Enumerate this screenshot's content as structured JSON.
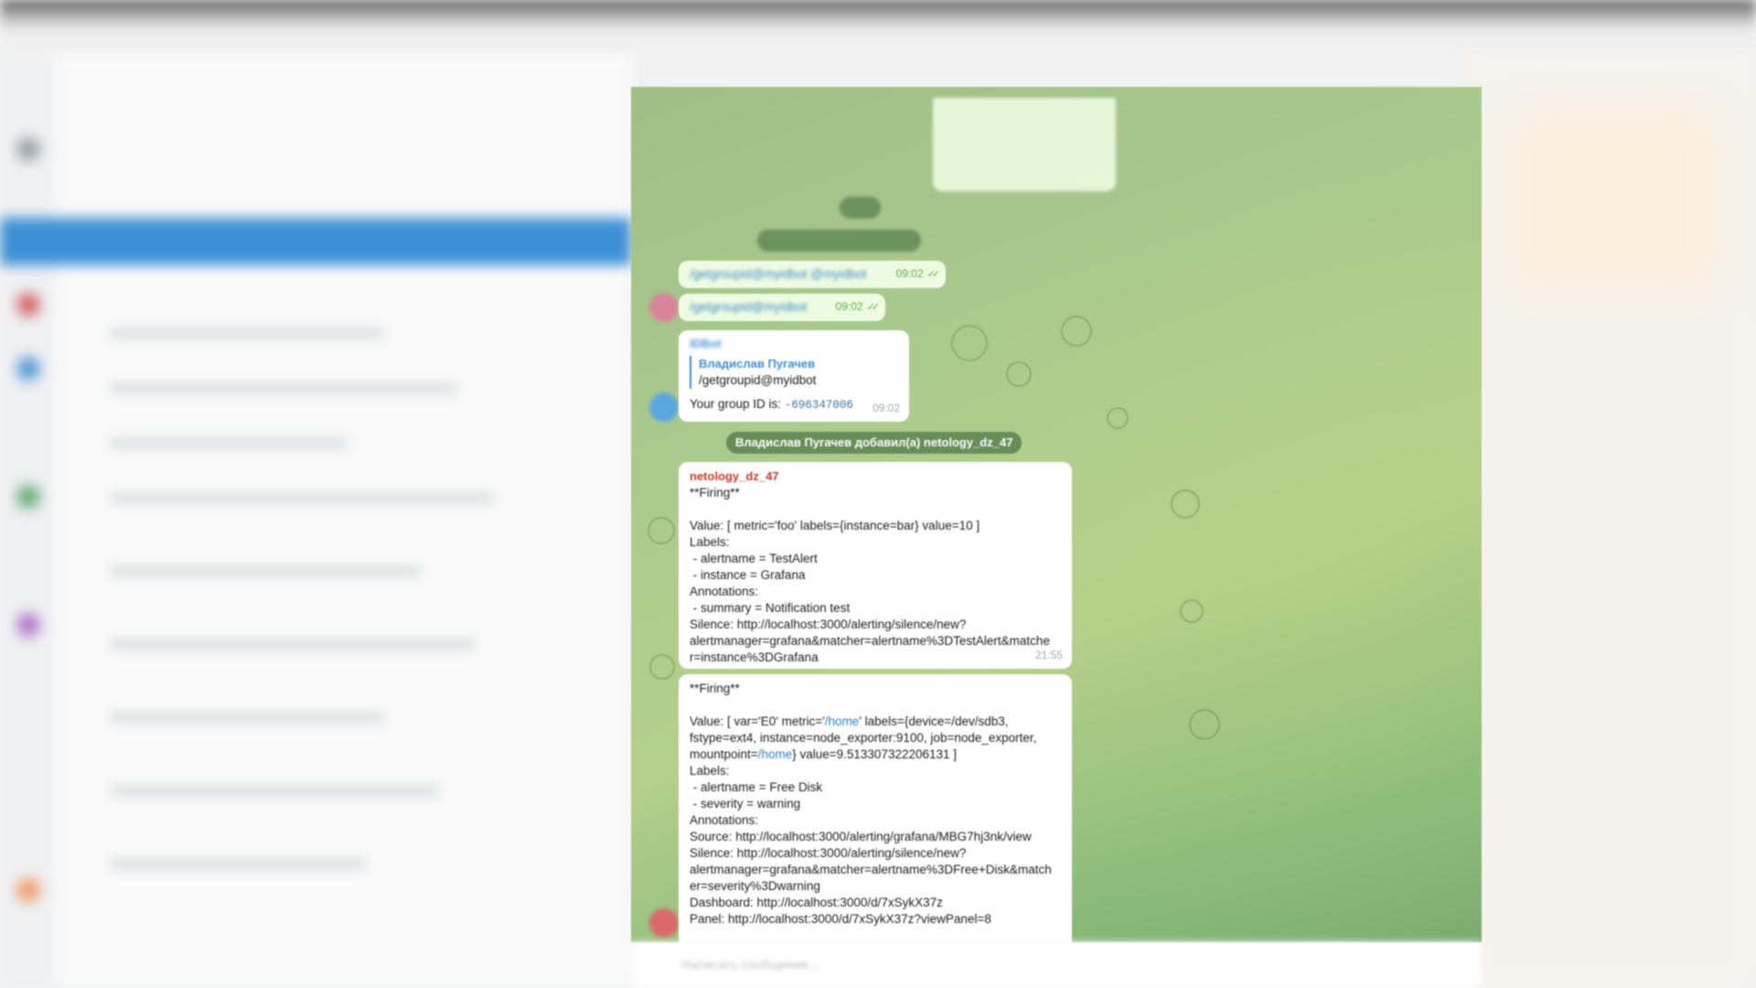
{
  "chat": {
    "outgoing_1": {
      "text": "/getgroupid@myidbot @myidbot",
      "time": "09:02"
    },
    "outgoing_2": {
      "text": "/getgroupid@myidbot",
      "time": "09:02"
    },
    "bot_reply": {
      "sender": "IDBot",
      "quote_name": "Владислав Пугачев",
      "quote_text": "/getgroupid@myidbot",
      "text_prefix": "Your group ID is:",
      "group_id": "-696347006",
      "time": "09:02"
    },
    "service_notice": "Владислав Пугачев добавил(а) netology_dz_47",
    "alert_1": {
      "sender": "netology_dz_47",
      "body": "**Firing**\n\nValue: [ metric='foo' labels={instance=bar} value=10 ]\nLabels:\n - alertname = TestAlert\n - instance = Grafana\nAnnotations:\n - summary = Notification test\nSilence: http://localhost:3000/alerting/silence/new?\nalertmanager=grafana&matcher=alertname%3DTestAlert&matche\nr=instance%3DGrafana",
      "time": "21:55"
    },
    "alert_2": {
      "firing": "**Firing**",
      "value_prefix": "Value: [ var='E0' metric='",
      "value_link": "/home",
      "value_mid": "' labels={device=/dev/sdb3,\nfstype=ext4, instance=node_exporter:9100, job=node_exporter,\nmountpoint=",
      "value_link_2": "/home",
      "value_suffix": "} value=9.513307322206131 ]",
      "rest": "Labels:\n - alertname = Free Disk\n - severity = warning\nAnnotations:\nSource: http://localhost:3000/alerting/grafana/MBG7hj3nk/view\nSilence: http://localhost:3000/alerting/silence/new?\nalertmanager=grafana&matcher=alertname%3DFree+Disk&match\ner=severity%3Dwarning\nDashboard: http://localhost:3000/d/7xSykX37z\nPanel: http://localhost:3000/d/7xSykX37z?viewPanel=8"
    }
  },
  "input": {
    "placeholder": "Написать сообщение..."
  },
  "colors": {
    "accent": "#3d8fd6",
    "sender": "#c0392b",
    "outgoing_bubble": "#eefbe2"
  }
}
